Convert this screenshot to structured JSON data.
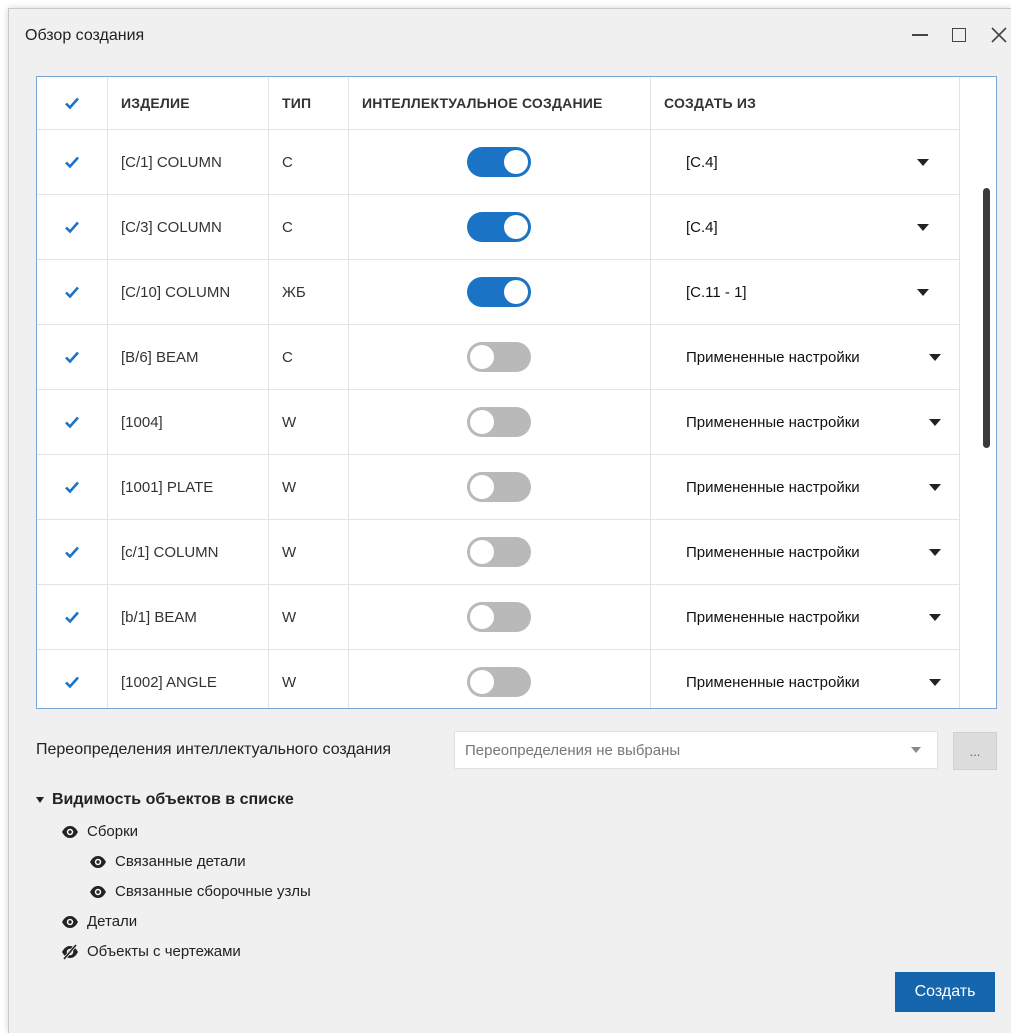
{
  "window": {
    "title": "Обзор создания"
  },
  "colors": {
    "accent": "#1a73c4",
    "toggle_off": "#b9b9b9",
    "button": "#1566ad"
  },
  "table": {
    "headers": {
      "item": "ИЗДЕЛИЕ",
      "type": "ТИП",
      "smart": "ИНТЕЛЛЕКТУАЛЬНОЕ СОЗДАНИЕ",
      "from": "СОЗДАТЬ ИЗ"
    },
    "rows": [
      {
        "checked": true,
        "item": "[C/1] COLUMN",
        "type": "C",
        "smart": true,
        "from": "[C.4]"
      },
      {
        "checked": true,
        "item": "[C/3] COLUMN",
        "type": "C",
        "smart": true,
        "from": "[C.4]"
      },
      {
        "checked": true,
        "item": "[C/10] COLUMN",
        "type": "ЖБ",
        "smart": true,
        "from": "[C.11 - 1]"
      },
      {
        "checked": true,
        "item": "[B/6] BEAM",
        "type": "C",
        "smart": false,
        "from": "Примененные настройки"
      },
      {
        "checked": true,
        "item": "[1004]",
        "type": "W",
        "smart": false,
        "from": "Примененные настройки"
      },
      {
        "checked": true,
        "item": "[1001] PLATE",
        "type": "W",
        "smart": false,
        "from": "Примененные настройки"
      },
      {
        "checked": true,
        "item": "[c/1] COLUMN",
        "type": "W",
        "smart": false,
        "from": "Примененные настройки"
      },
      {
        "checked": true,
        "item": "[b/1] BEAM",
        "type": "W",
        "smart": false,
        "from": "Примененные настройки"
      },
      {
        "checked": true,
        "item": "[1002] ANGLE",
        "type": "W",
        "smart": false,
        "from": "Примененные настройки"
      }
    ]
  },
  "overrides": {
    "label": "Переопределения интеллектуального создания",
    "placeholder": "Переопределения не выбраны",
    "more_label": "..."
  },
  "visibility": {
    "title": "Видимость объектов в списке",
    "items": [
      {
        "label": "Сборки",
        "visible": true
      },
      {
        "label": "Связанные детали",
        "visible": true
      },
      {
        "label": "Связанные сборочные узлы",
        "visible": true
      },
      {
        "label": "Детали",
        "visible": true
      },
      {
        "label": "Объекты с чертежами",
        "visible": false
      }
    ]
  },
  "actions": {
    "create_label": "Создать"
  }
}
